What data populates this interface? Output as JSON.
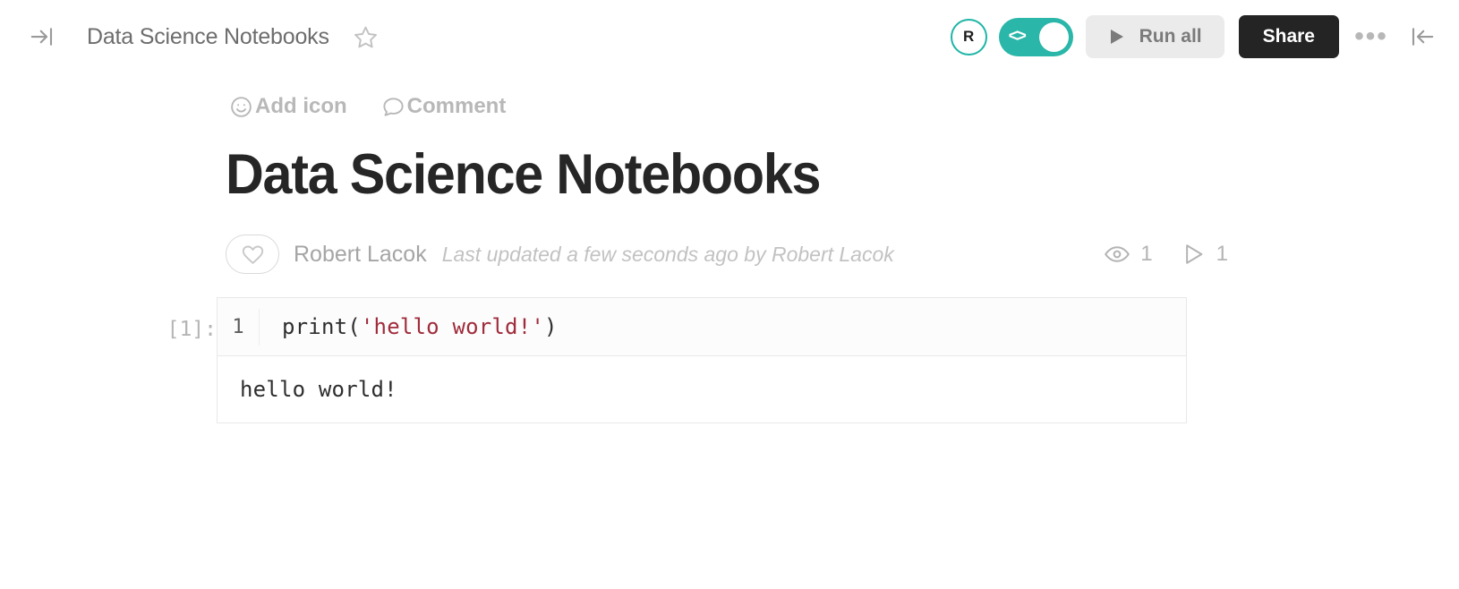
{
  "topbar": {
    "expand_icon": "expand-sidebar-icon",
    "title": "Data Science Notebooks",
    "star_icon": "star-icon",
    "avatar_initial": "R",
    "toggle_glyph": "<>",
    "toggle_state": "on",
    "run_all_label": "Run all",
    "run_all_icon": "play-icon",
    "share_label": "Share",
    "more_label": "•••",
    "collapse_icon": "collapse-left-icon"
  },
  "meta_actions": [
    {
      "icon": "smiley-icon",
      "label": "Add icon"
    },
    {
      "icon": "comment-bubble-icon",
      "label": "Comment"
    }
  ],
  "document": {
    "title": "Data Science Notebooks",
    "author": "Robert Lacok",
    "updated": "Last updated a few seconds ago by Robert Lacok",
    "like_icon": "heart-icon"
  },
  "stats": [
    {
      "icon": "eye-icon",
      "value": "1"
    },
    {
      "icon": "play-outline-icon",
      "value": "1"
    }
  ],
  "cell": {
    "prompt": "[1]:",
    "line_number": "1",
    "code_prefix": "print(",
    "code_string": "'hello world!'",
    "code_suffix": ")",
    "output": "hello world!"
  },
  "colors": {
    "accent_teal": "#2ab6a8",
    "share_bg": "#242424",
    "run_all_bg": "#ebebeb",
    "string_red": "#a02c3c",
    "muted_text": "#b8b8b8"
  }
}
